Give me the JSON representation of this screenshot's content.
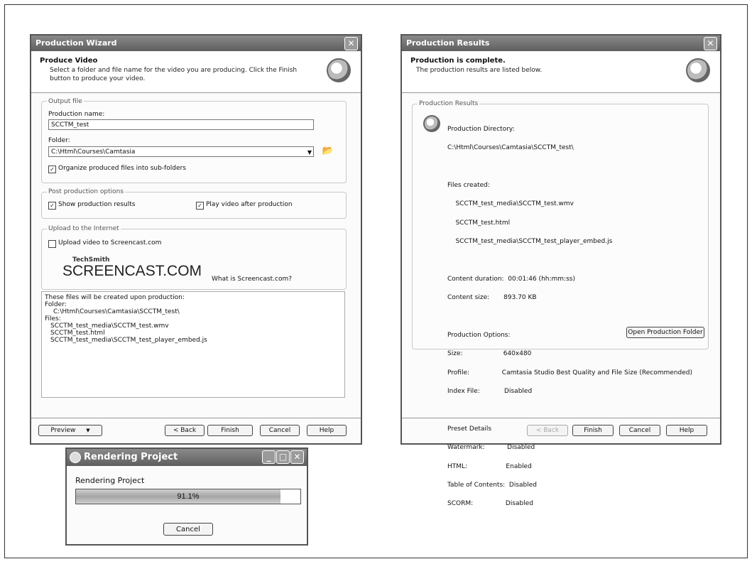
{
  "wizard": {
    "title": "Production Wizard",
    "header_title": "Produce Video",
    "header_desc": "Select a folder and file name for the video you are producing.  Click the Finish button to produce your video.",
    "output_group": "Output file",
    "production_name_label": "Production name:",
    "production_name_value": "SCCTM_test",
    "folder_label": "Folder:",
    "folder_value": "C:\\Html\\Courses\\Camtasia",
    "organize_label": "Organize produced files into sub-folders",
    "post_group": "Post production options",
    "show_results_label": "Show production results",
    "play_after_label": "Play video after production",
    "upload_group": "Upload to the Internet",
    "upload_label": "Upload video to Screencast.com",
    "techsmith_text": "TechSmith",
    "screencast_logo": "SCREENCAST.COM",
    "what_is_link": "What is Screencast.com?",
    "files_info": [
      "These files will be created upon production:",
      "Folder:",
      "    C:\\Html\\Courses\\Camtasia\\SCCTM_test\\",
      "Files:",
      "    SCCTM_test_media\\SCCTM_test.wmv",
      "    SCCTM_test.html",
      "    SCCTM_test_media\\SCCTM_test_player_embed.js"
    ],
    "preview_button": "Preview",
    "back_button": "< Back",
    "finish_button": "Finish",
    "cancel_button": "Cancel",
    "help_button": "Help"
  },
  "results": {
    "title": "Production Results",
    "header_title": "Production is complete.",
    "header_desc": "The production results are listed below.",
    "group_label": "Production Results",
    "lines": [
      "Production Directory:",
      "C:\\Html\\Courses\\Camtasia\\SCCTM_test\\",
      "",
      "Files created:",
      "    SCCTM_test_media\\SCCTM_test.wmv",
      "    SCCTM_test.html",
      "    SCCTM_test_media\\SCCTM_test_player_embed.js",
      "",
      "Content duration:  00:01:46 (hh:mm:ss)",
      "Content size:       893.70 KB",
      "",
      "Production Options:",
      "Size:                    640x480",
      "Profile:                Camtasia Studio Best Quality and File Size (Recommended)",
      "Index File:            Disabled",
      "",
      "Preset Details",
      "Watermark:           Disabled",
      "HTML:                   Enabled",
      "Table of Contents:  Disabled",
      "SCORM:                Disabled"
    ],
    "open_folder_button": "Open Production Folder",
    "back_button": "< Back",
    "finish_button": "Finish",
    "cancel_button": "Cancel",
    "help_button": "Help"
  },
  "render": {
    "title": "Rendering Project",
    "label": "Rendering Project",
    "progress_text": "91.1%",
    "progress_value": 0.911,
    "cancel_button": "Cancel"
  }
}
